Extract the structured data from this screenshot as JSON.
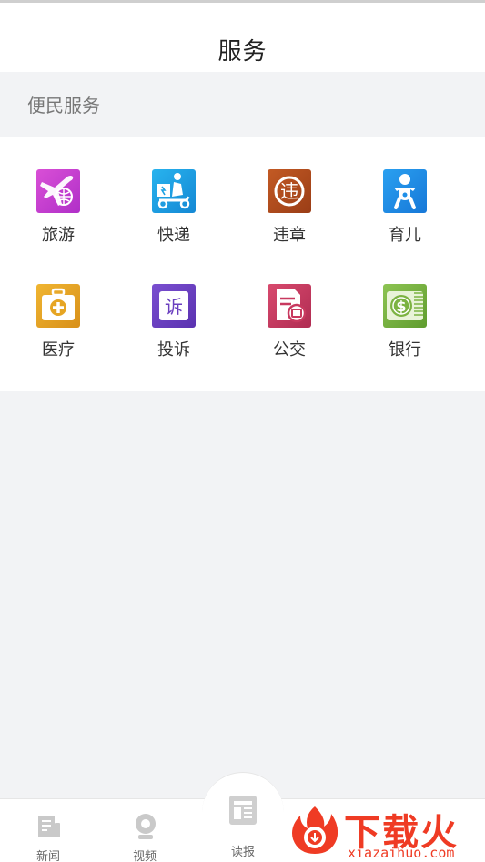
{
  "header": {
    "title": "服务"
  },
  "section": {
    "title": "便民服务"
  },
  "services": [
    {
      "label": "旅游",
      "icon": "travel-plane-globe-icon",
      "color": "#c03bd0"
    },
    {
      "label": "快递",
      "icon": "courier-scooter-icon",
      "color": "#1ba1e3"
    },
    {
      "label": "违章",
      "icon": "traffic-violation-icon",
      "color": "#b44d1e"
    },
    {
      "label": "育儿",
      "icon": "baby-icon",
      "color": "#1e8fe8"
    },
    {
      "label": "医疗",
      "icon": "medical-kit-icon",
      "color": "#e6a523"
    },
    {
      "label": "投诉",
      "icon": "complaint-icon",
      "color": "#6a3fbf"
    },
    {
      "label": "公交",
      "icon": "bus-card-icon",
      "color": "#c8395f"
    },
    {
      "label": "银行",
      "icon": "bank-money-icon",
      "color": "#7cb342"
    }
  ],
  "tabbar": {
    "tabs": [
      {
        "label": "新闻",
        "icon": "news-icon"
      },
      {
        "label": "视频",
        "icon": "video-icon"
      },
      {
        "label": "读报",
        "icon": "newspaper-icon"
      }
    ]
  },
  "watermark": {
    "brand": "下载火",
    "url": "xiazaihuo.com",
    "color": "#ef3b24"
  }
}
